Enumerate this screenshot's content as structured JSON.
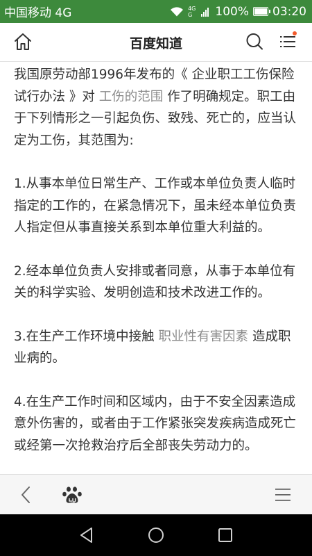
{
  "status_bar": {
    "carrier": "中国移动 4G",
    "network_small_top": "4G",
    "network_small_bottom": "G",
    "battery": "100%",
    "battery_level": 1.0,
    "time": "03:20"
  },
  "header": {
    "title": "百度知道",
    "notification_color": "#f25a2b"
  },
  "article": {
    "intro": {
      "before_book": "我国原劳动部1996年发布的《 企业职工工伤保险试行办法 》对 ",
      "link": "工伤的范围",
      "after_link": " 作了明确规定。职工由于下列情形之一引起负伤、致残、死亡的，应当认定为工伤，其范围为:"
    },
    "item1": "1.从事本单位日常生产、工作或本单位负责人临时指定的工作的，在紧急情况下，虽未经本单位负责人指定但从事直接关系到本单位重大利益的。",
    "item2": "2.经本单位负责人安排或者同意，从事于本单位有关的科学实验、发明创造和技术改进工作的。",
    "item3": {
      "before_link": "3.在生产工作环境中接触 ",
      "link": "职业性有害因素",
      "after_link": " 造成职业病的。"
    },
    "item4": "4.在生产工作时间和区域内，由于不安全因素造成意外伤害的，或者由于工作紧张突发疾病造成死亡或经第一次抢救治疗后全部丧失劳动力的。"
  },
  "toolbar": {
    "icons": [
      "back-icon",
      "baidu-paw-icon",
      "menu-icon"
    ]
  },
  "nav_bar": {
    "icons": [
      "nav-back-icon",
      "nav-home-icon",
      "nav-recent-icon"
    ]
  },
  "colors": {
    "status_bar": "#3d8a3c",
    "link": "#8b8b8b",
    "text": "#333333"
  }
}
